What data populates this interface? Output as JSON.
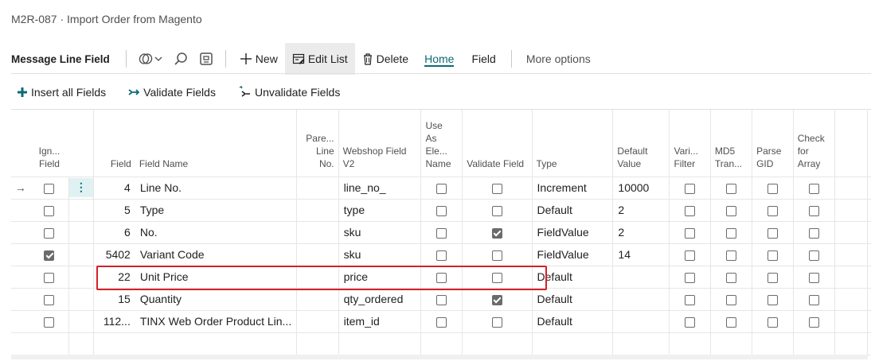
{
  "window": {
    "title": "M2R-087 · Import Order from Magento"
  },
  "actionbar": {
    "page_name": "Message Line Field",
    "new_label": "New",
    "edit_list_label": "Edit List",
    "delete_label": "Delete",
    "tab_home": "Home",
    "tab_field": "Field",
    "more_options": "More options"
  },
  "subbar": {
    "insert_all": "Insert all Fields",
    "validate": "Validate Fields",
    "unvalidate": "Unvalidate Fields"
  },
  "columns": {
    "ignore_field": [
      "Ign...",
      "Field"
    ],
    "field": "Field",
    "field_name": "Field Name",
    "parent_line_no": [
      "Pare...",
      "Line",
      "No."
    ],
    "webshop_field": [
      "Webshop Field",
      "V2"
    ],
    "use_as_element_name": [
      "Use",
      "As",
      "Ele...",
      "Name"
    ],
    "validate_field": "Validate Field",
    "type": "Type",
    "default_value": [
      "Default",
      "Value"
    ],
    "variant_filter": [
      "Vari...",
      "Filter"
    ],
    "md5_transform": [
      "MD5",
      "Tran..."
    ],
    "parse_gid": [
      "Parse",
      "GID"
    ],
    "check_for_array": [
      "Check",
      "for",
      "Array"
    ]
  },
  "rows": [
    {
      "ignore": false,
      "field": "4",
      "name": "Line No.",
      "parent": "",
      "webshop": "line_no_",
      "use_as_name": false,
      "validate": false,
      "type": "Increment",
      "default": "10000",
      "variant": false,
      "md5": false,
      "gid": false,
      "array": false
    },
    {
      "ignore": false,
      "field": "5",
      "name": "Type",
      "parent": "",
      "webshop": "type",
      "use_as_name": false,
      "validate": false,
      "type": "Default",
      "default": "2",
      "variant": false,
      "md5": false,
      "gid": false,
      "array": false
    },
    {
      "ignore": false,
      "field": "6",
      "name": "No.",
      "parent": "",
      "webshop": "sku",
      "use_as_name": false,
      "validate": true,
      "type": "FieldValue",
      "default": "2",
      "variant": false,
      "md5": false,
      "gid": false,
      "array": false
    },
    {
      "ignore": true,
      "field": "5402",
      "name": "Variant Code",
      "parent": "",
      "webshop": "sku",
      "use_as_name": false,
      "validate": false,
      "type": "FieldValue",
      "default": "14",
      "variant": false,
      "md5": false,
      "gid": false,
      "array": false
    },
    {
      "ignore": false,
      "field": "22",
      "name": "Unit Price",
      "parent": "",
      "webshop": "price",
      "use_as_name": false,
      "validate": false,
      "type": "Default",
      "default": "",
      "variant": false,
      "md5": false,
      "gid": false,
      "array": false
    },
    {
      "ignore": false,
      "field": "15",
      "name": "Quantity",
      "parent": "",
      "webshop": "qty_ordered",
      "use_as_name": false,
      "validate": true,
      "type": "Default",
      "default": "",
      "variant": false,
      "md5": false,
      "gid": false,
      "array": false
    },
    {
      "ignore": false,
      "field": "112...",
      "name": "TINX Web Order Product Lin...",
      "parent": "",
      "webshop": "item_id",
      "use_as_name": false,
      "validate": false,
      "type": "Default",
      "default": "",
      "variant": false,
      "md5": false,
      "gid": false,
      "array": false
    }
  ],
  "colors": {
    "accent": "#0d6a73",
    "highlight": "#d6202a",
    "checkbox": "#6b6b6b"
  }
}
